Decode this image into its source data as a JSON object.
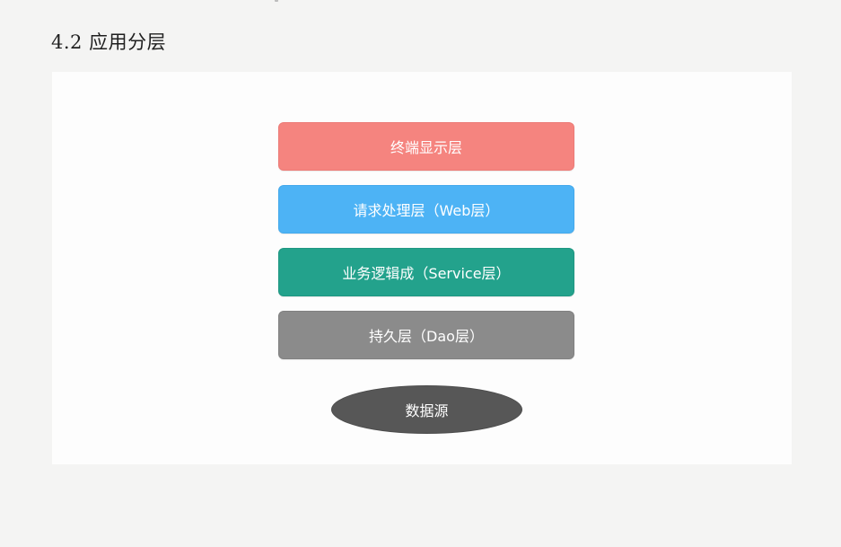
{
  "slide": {
    "title": "4.2 应用分层"
  },
  "diagram": {
    "layers": [
      {
        "label": "终端显示层",
        "color": "#f5847f"
      },
      {
        "label": "请求处理层（Web层）",
        "color": "#4db3f5"
      },
      {
        "label": "业务逻辑成（Service层）",
        "color": "#23a28c"
      },
      {
        "label": "持久层（Dao层）",
        "color": "#8b8b8b"
      }
    ],
    "datasource": {
      "label": "数据源",
      "color": "#575757"
    }
  }
}
